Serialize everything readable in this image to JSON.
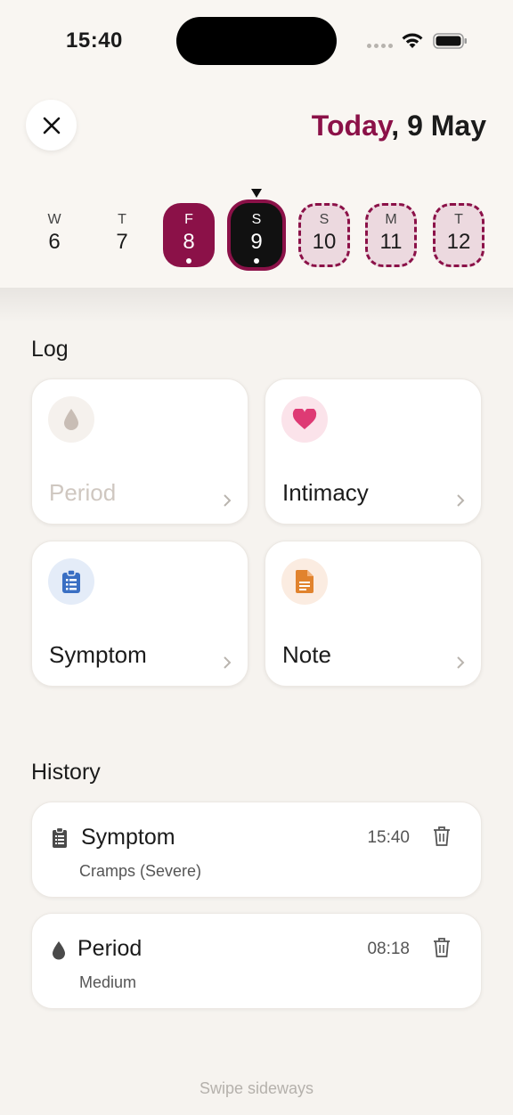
{
  "status_bar": {
    "time": "15:40",
    "icons": [
      "signal-icon",
      "wifi-icon",
      "battery-icon"
    ]
  },
  "header": {
    "close_icon": "close-icon",
    "today_label": "Today",
    "date_rest": ", 9 May",
    "accent_color": "#8b1148"
  },
  "week": {
    "days": [
      {
        "letter": "W",
        "number": "6",
        "state": "normal"
      },
      {
        "letter": "T",
        "number": "7",
        "state": "normal"
      },
      {
        "letter": "F",
        "number": "8",
        "state": "period",
        "has_entry": true
      },
      {
        "letter": "S",
        "number": "9",
        "state": "selected",
        "has_entry": true
      },
      {
        "letter": "S",
        "number": "10",
        "state": "predicted"
      },
      {
        "letter": "M",
        "number": "11",
        "state": "predicted"
      },
      {
        "letter": "T",
        "number": "12",
        "state": "predicted"
      }
    ]
  },
  "log": {
    "heading": "Log",
    "cards": [
      {
        "label": "Period",
        "icon": "drop-icon",
        "disabled": true
      },
      {
        "label": "Intimacy",
        "icon": "heart-icon",
        "disabled": false
      },
      {
        "label": "Symptom",
        "icon": "clipboard-icon",
        "disabled": false
      },
      {
        "label": "Note",
        "icon": "document-icon",
        "disabled": false
      }
    ]
  },
  "history": {
    "heading": "History",
    "entries": [
      {
        "title": "Symptom",
        "time": "15:40",
        "detail": "Cramps (Severe)",
        "icon": "clipboard-icon"
      },
      {
        "title": "Period",
        "time": "08:18",
        "detail": "Medium",
        "icon": "drop-icon"
      }
    ]
  },
  "footer": {
    "hint": "Swipe sideways"
  }
}
